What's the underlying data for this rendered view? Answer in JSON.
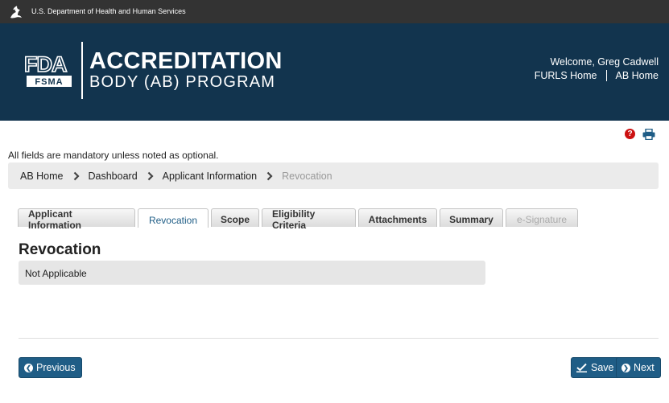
{
  "gov_bar": {
    "text": "U.S. Department of Health and Human Services",
    "icon": "hhs-eagle-icon"
  },
  "header": {
    "logo_fda": "FDA",
    "logo_fsma": "FSMA",
    "title_line1": "ACCREDITATION",
    "title_line2": "BODY (AB) PROGRAM",
    "welcome": "Welcome, Greg Cadwell",
    "links": [
      "FURLS Home",
      "AB Home"
    ]
  },
  "utility": {
    "help_icon": "help-icon",
    "print_icon": "print-icon"
  },
  "mandatory_note": "All fields are mandatory unless noted as optional.",
  "breadcrumb": [
    "AB Home",
    "Dashboard",
    "Applicant Information",
    "Revocation"
  ],
  "tabs": [
    {
      "label": "Applicant Information",
      "state": "normal"
    },
    {
      "label": "Revocation",
      "state": "active"
    },
    {
      "label": "Scope",
      "state": "normal"
    },
    {
      "label": "Eligibility Criteria",
      "state": "normal"
    },
    {
      "label": "Attachments",
      "state": "normal"
    },
    {
      "label": "Summary",
      "state": "normal"
    },
    {
      "label": "e-Signature",
      "state": "disabled"
    }
  ],
  "section": {
    "title": "Revocation",
    "value": "Not Applicable"
  },
  "buttons": {
    "previous": "Previous",
    "save": "Save",
    "next": "Next"
  },
  "colors": {
    "header_bg": "#12344e",
    "gov_bar_bg": "#333333",
    "accent": "#1f5d86",
    "help_red": "#cc1111"
  }
}
